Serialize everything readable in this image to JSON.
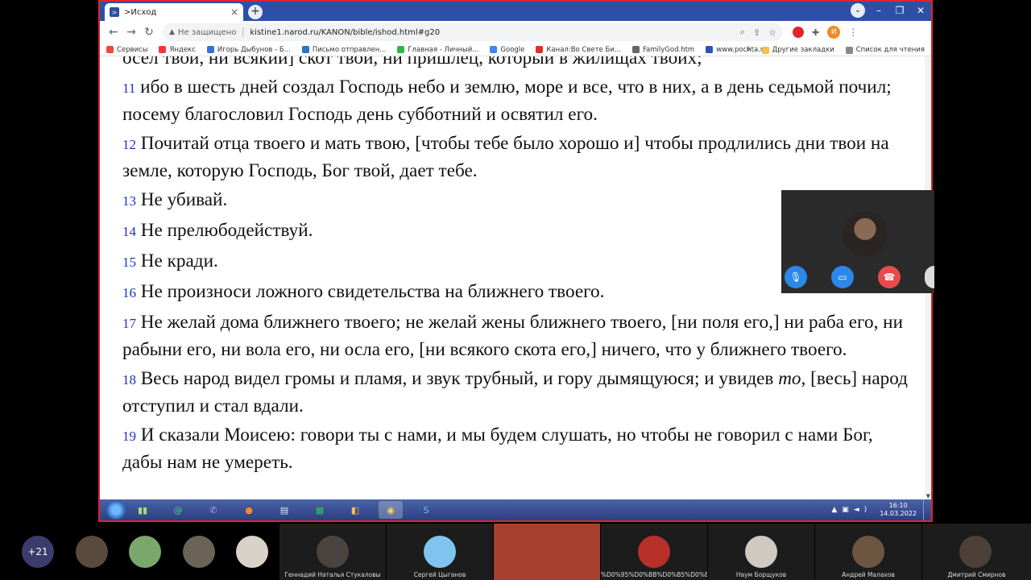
{
  "browser": {
    "tab_title": ">Исход",
    "tab_favicon": ">",
    "new_tab": "+",
    "url": "kistine1.narod.ru/KANON/bible/ishod.html#g20",
    "security": "Не защищено",
    "profile_initial": "И"
  },
  "bookmarks": {
    "items": [
      "Сервисы",
      "Яндекс",
      "Игорь Дыбунов - Б...",
      "Письмо отправлен...",
      "Главная - Личный...",
      "Google",
      "Канал:Во Свете Би...",
      "FamilyGod.htm",
      "www.pochta.ru"
    ],
    "more": "»",
    "other": "Другие закладки",
    "reading_list": "Список для чтения"
  },
  "bible": {
    "partial_line": "осел твой, ни всякий] скот твой, ни пришлец, который в жилищах твоих;",
    "verses": [
      {
        "num": "11",
        "text": "ибо в шесть дней создал Господь небо и землю, море и все, что в них, а в день седьмой почил; посему благословил Господь день субботний и освятил его."
      },
      {
        "num": "12",
        "text": "Почитай отца твоего и мать твою, [чтобы тебе было хорошо и] чтобы продлились дни твои на земле, которую Господь, Бог твой, дает тебе."
      },
      {
        "num": "13",
        "text": "Не убивай."
      },
      {
        "num": "14",
        "text": "Не прелюбодействуй."
      },
      {
        "num": "15",
        "text": "Не кради."
      },
      {
        "num": "16",
        "text": "Не произноси ложного свидетельства на ближнего твоего."
      },
      {
        "num": "17",
        "text": "Не желай дома ближнего твоего; не желай жены ближнего твоего, [ни поля его,] ни раба его, ни рабыни его, ни вола его, ни осла его, [ни всякого скота его,] ничего, что у ближнего твоего."
      },
      {
        "num": "18",
        "text_a": "Весь народ видел громы и пламя, и звук трубный, и гору дымящуюся; и увидев ",
        "text_em": "то,",
        "text_b": " [весь] народ отступил и стал вдали."
      },
      {
        "num": "19",
        "text": "И сказали Моисею: говори ты с нами, и мы будем слушать, но чтобы не говорил с нами Бог, дабы нам не умереть."
      }
    ]
  },
  "taskbar": {
    "time": "16:10",
    "date": "14.03.2022"
  },
  "participants": {
    "more_count": "+21",
    "tiles": [
      "Геннадий Наталья Стукаловы",
      "Сергей Цыганов",
      "",
      "%D0%95%D0%BB%D0%B5%D0%B...",
      "Наум Борщуков",
      "Андрей Малахов",
      "Дмитрий Смирнов"
    ]
  }
}
